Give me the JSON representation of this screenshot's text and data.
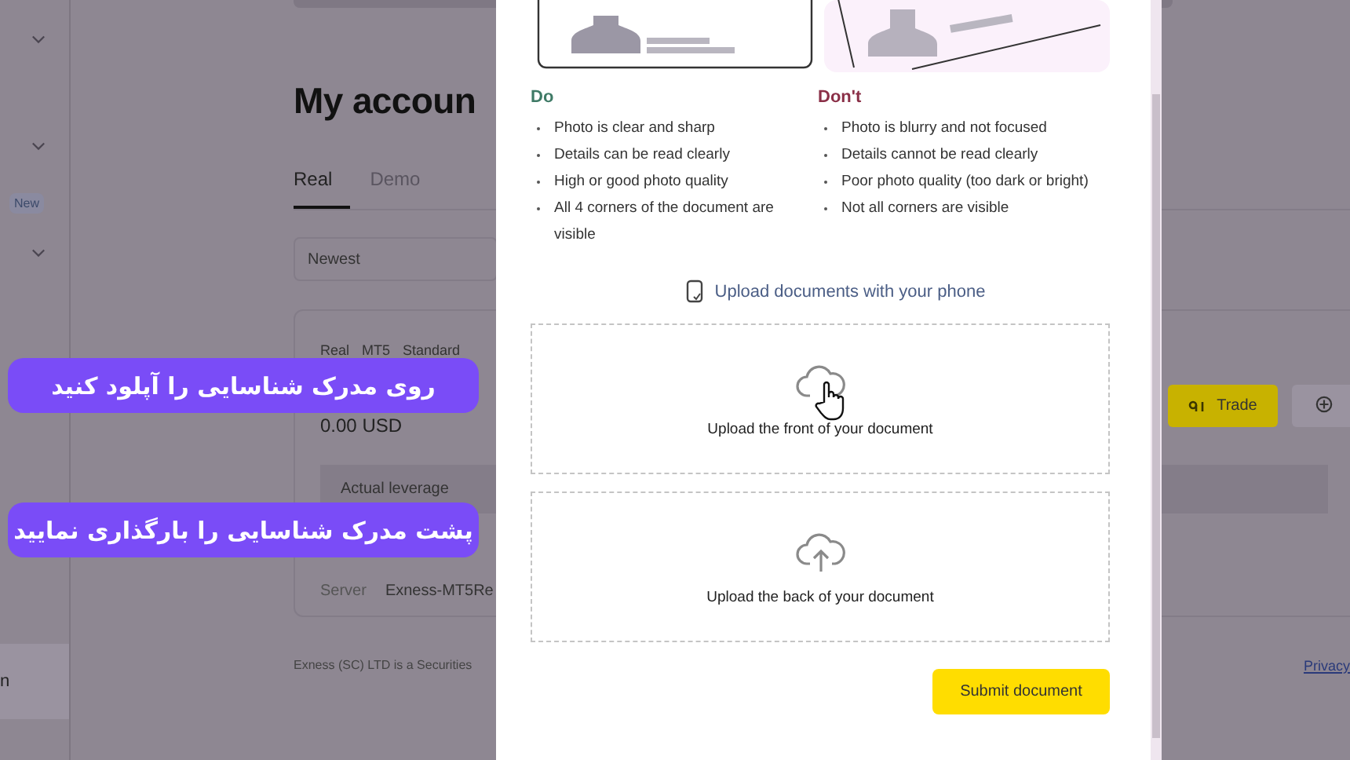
{
  "sidebar": {
    "badge": "New",
    "partial_item": "n"
  },
  "page": {
    "title": "My accoun",
    "tabs": [
      {
        "label": "Real",
        "selected": true
      },
      {
        "label": "Demo",
        "selected": false
      }
    ],
    "sort": {
      "value": "Newest"
    },
    "account": {
      "tags": [
        "Real",
        "MT5",
        "Standard"
      ],
      "balance": "0.00 USD",
      "leverage_label": "Actual leverage",
      "server_label": "Server",
      "server_value": "Exness-MT5Re",
      "trade_button": "Trade"
    },
    "footer": "Exness (SC) LTD is a Securities",
    "privacy_link": "Privacy"
  },
  "modal": {
    "do": {
      "heading": "Do",
      "items": [
        "Photo is clear and sharp",
        "Details can be read clearly",
        "High or good photo quality",
        "All 4 corners of the document are visible"
      ]
    },
    "dont": {
      "heading": "Don't",
      "items": [
        "Photo is blurry and not focused",
        "Details cannot be read clearly",
        "Poor photo quality (too dark or bright)",
        "Not all corners are visible"
      ]
    },
    "phone_link": "Upload documents with your phone",
    "dropzones": [
      {
        "label": "Upload the front of your document",
        "hovered": true
      },
      {
        "label": "Upload the back of your document",
        "hovered": false
      }
    ],
    "submit": "Submit document"
  },
  "callouts": [
    "روی مدرک شناسایی را آپلود کنید",
    "پشت مدرک شناسایی را بارگذاری نمایید"
  ]
}
